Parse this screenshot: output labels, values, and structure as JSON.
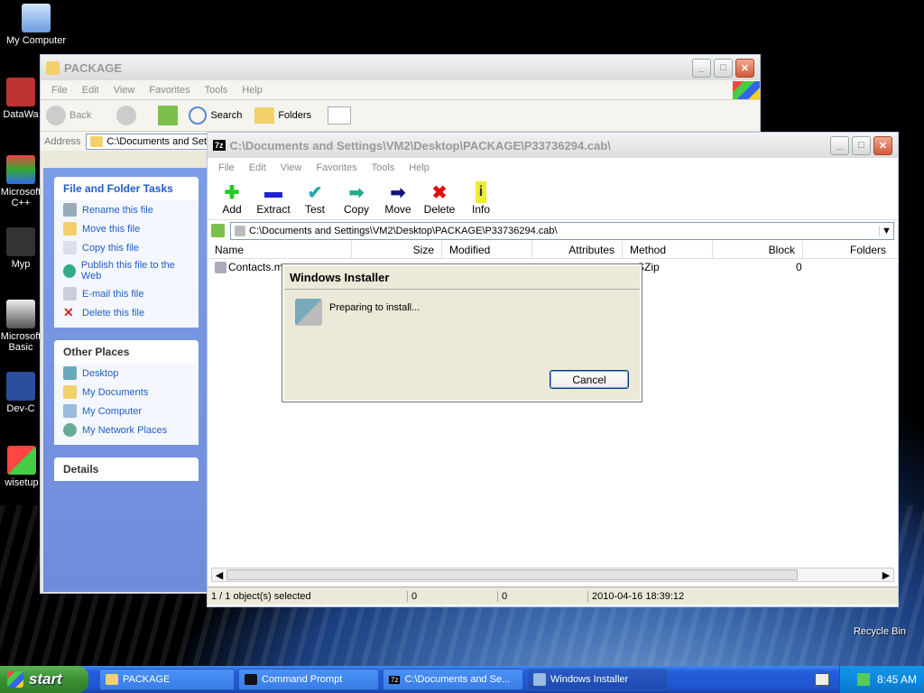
{
  "desktop": {
    "icons": [
      {
        "label": "My Computer"
      },
      {
        "label": "DataWa"
      },
      {
        "label": "Microsoft C++"
      },
      {
        "label": "Myp"
      },
      {
        "label": "Microsoft Basic"
      },
      {
        "label": "Dev-C"
      },
      {
        "label": "wisetup"
      },
      {
        "label": "Recycle Bin"
      }
    ]
  },
  "explorer": {
    "title": "PACKAGE",
    "menu": [
      "File",
      "Edit",
      "View",
      "Favorites",
      "Tools",
      "Help"
    ],
    "toolbar": {
      "back": "Back",
      "search": "Search",
      "folders": "Folders"
    },
    "address_label": "Address",
    "address_value": "C:\\Documents and Sett",
    "file_tasks": {
      "title": "File and Folder Tasks",
      "items": [
        "Rename this file",
        "Move this file",
        "Copy this file",
        "Publish this file to the Web",
        "E-mail this file",
        "Delete this file"
      ]
    },
    "other_places": {
      "title": "Other Places",
      "items": [
        "Desktop",
        "My Documents",
        "My Computer",
        "My Network Places"
      ]
    },
    "details": {
      "title": "Details"
    }
  },
  "sevenzip": {
    "title": "C:\\Documents and Settings\\VM2\\Desktop\\PACKAGE\\P33736294.cab\\",
    "app_badge": "7z",
    "menu": [
      "File",
      "Edit",
      "View",
      "Favorites",
      "Tools",
      "Help"
    ],
    "tools": [
      "Add",
      "Extract",
      "Test",
      "Copy",
      "Move",
      "Delete",
      "Info"
    ],
    "path": "C:\\Documents and Settings\\VM2\\Desktop\\PACKAGE\\P33736294.cab\\",
    "columns": [
      "Name",
      "Size",
      "Modified",
      "Attributes",
      "Method",
      "Block",
      "Folders"
    ],
    "rows": [
      {
        "name": "Contacts.ms",
        "method": "SZip",
        "block": "0"
      }
    ],
    "status": {
      "selected": "1 / 1 object(s) selected",
      "size": "0",
      "packed": "0",
      "date": "2010-04-16 18:39:12"
    }
  },
  "installer": {
    "title": "Windows Installer",
    "message": "Preparing to install...",
    "cancel": "Cancel"
  },
  "taskbar": {
    "start": "start",
    "buttons": [
      "PACKAGE",
      "Command Prompt",
      "C:\\Documents and Se...",
      "Windows Installer"
    ],
    "time": "8:45 AM"
  }
}
